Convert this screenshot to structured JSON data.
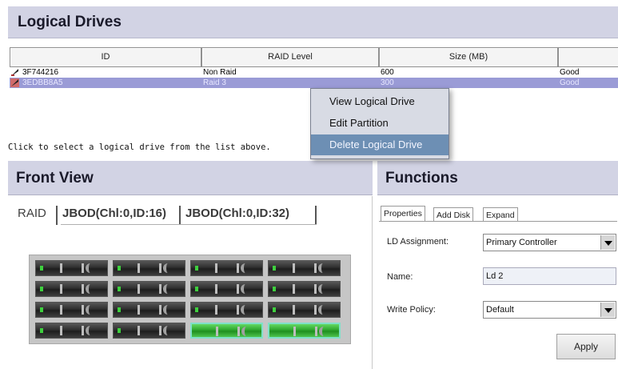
{
  "logical_drives": {
    "title": "Logical Drives",
    "columns": [
      "ID",
      "RAID Level",
      "Size (MB)",
      ""
    ],
    "rows": [
      {
        "id": "3F744216",
        "raid": "Non Raid",
        "size": "600",
        "status": "Good",
        "selected": false
      },
      {
        "id": "3EDBB8A5",
        "raid": "Raid 3",
        "size": "300",
        "status": "Good",
        "selected": true
      }
    ],
    "hint": "Click to select a logical drive from the list above."
  },
  "context_menu": {
    "items": [
      "View Logical Drive",
      "Edit Partition",
      "Delete Logical Drive"
    ],
    "highlighted_index": 2
  },
  "front_view": {
    "title": "Front View",
    "tabs": [
      "RAID",
      "JBOD(Chl:0,ID:16)",
      "JBOD(Chl:0,ID:32)"
    ],
    "active_tab": 0,
    "bays_highlighted": [
      14,
      15
    ]
  },
  "functions": {
    "title": "Functions",
    "tabs": [
      "Properties",
      "Add Disk",
      "Expand"
    ],
    "active_tab": 0,
    "ld_assignment_label": "LD Assignment:",
    "ld_assignment_value": "Primary Controller",
    "name_label": "Name:",
    "name_value": "Ld 2",
    "write_policy_label": "Write Policy:",
    "write_policy_value": "Default",
    "apply_label": "Apply"
  },
  "colors": {
    "header_bg": "#d2d3e4",
    "selected_row": "#9a9bd6",
    "menu_highlight": "#6d8fb4"
  }
}
